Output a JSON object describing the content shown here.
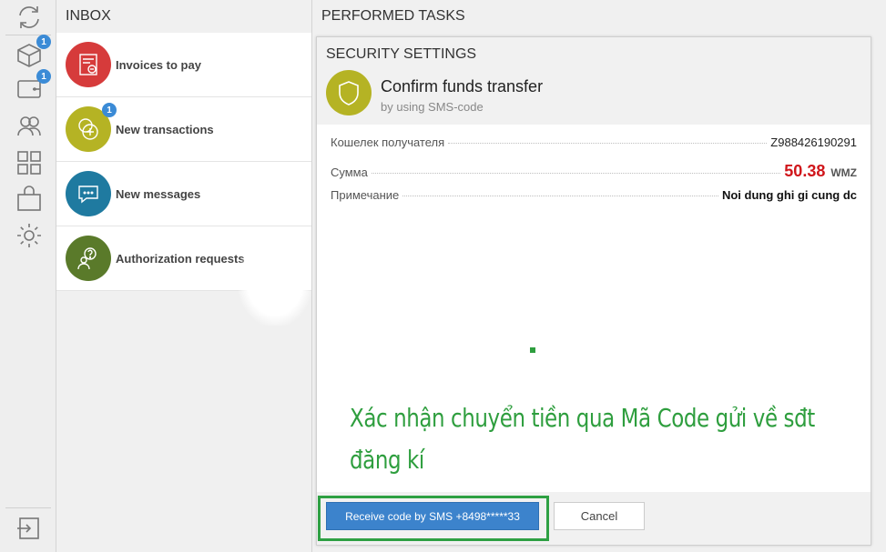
{
  "rail": {
    "items": [
      {
        "icon": "refresh-icon",
        "badge": ""
      },
      {
        "icon": "open-box-icon",
        "badge": "1"
      },
      {
        "icon": "wallet-icon",
        "badge": "1"
      },
      {
        "icon": "contacts-icon",
        "badge": ""
      },
      {
        "icon": "apps-grid-icon",
        "badge": ""
      },
      {
        "icon": "shopping-bag-icon",
        "badge": ""
      },
      {
        "icon": "gear-icon",
        "badge": ""
      },
      {
        "icon": "logout-icon",
        "badge": ""
      }
    ]
  },
  "inbox": {
    "title": "INBOX",
    "items": [
      {
        "label": "Invoices to pay",
        "icon": "invoice-icon",
        "color": "#d63b3b",
        "badge": ""
      },
      {
        "label": "New transactions",
        "icon": "coins-plus-icon",
        "color": "#b5b324",
        "badge": "1"
      },
      {
        "label": "New messages",
        "icon": "chat-icon",
        "color": "#1f7aa0",
        "badge": ""
      },
      {
        "label": "Authorization requests",
        "icon": "user-question-icon",
        "color": "#5a7a2a",
        "badge": ""
      }
    ]
  },
  "tasks": {
    "title": "PERFORMED TASKS"
  },
  "dialog": {
    "section_title": "SECURITY SETTINGS",
    "confirm_title": "Confirm funds transfer",
    "confirm_sub": "by using SMS-code",
    "shield_color": "#b5b324",
    "fields": [
      {
        "key": "Кошелек получателя",
        "value": "Z988426190291"
      },
      {
        "key": "Сумма",
        "amount": "50.38",
        "currency": "WMZ"
      },
      {
        "key": "Примечание",
        "value": "Noi dung ghi gi cung dc"
      }
    ],
    "annotation_line1": "Xác nhận chuyển tiền qua Mã Code gửi về sđt",
    "annotation_line2": "đăng kí",
    "sms_button": "Receive code by SMS +8498*****33",
    "cancel_button": "Cancel",
    "accent": "#3c83cc",
    "highlight_color": "#2ea043",
    "amount_color": "#d0161b"
  }
}
